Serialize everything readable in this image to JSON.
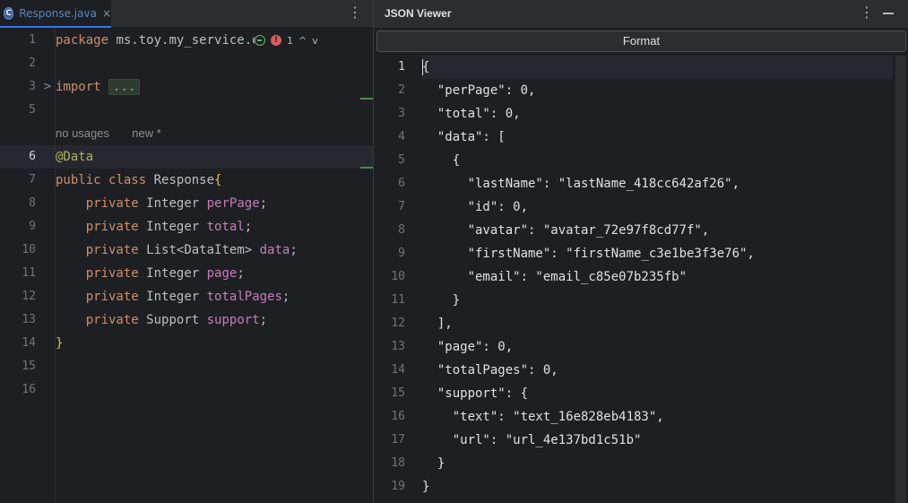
{
  "editor": {
    "tab": {
      "icon_letter": "C",
      "filename": "Response.java",
      "close_glyph": "×"
    },
    "menu_glyph": "⋮",
    "inspection": {
      "error_count": "1",
      "error_glyph": "!",
      "up_glyph": "^",
      "down_glyph": "v"
    },
    "line_numbers": [
      "1",
      "2",
      "3",
      "5",
      "6",
      "7",
      "8",
      "9",
      "10",
      "11",
      "12",
      "13",
      "14",
      "15",
      "16"
    ],
    "lines": {
      "l1_kw": "package",
      "l1_pkg": " ms.toy.my_service.d",
      "l3_kw": "import",
      "l3_fold": "...",
      "hint_usages": "no usages",
      "hint_new": "new *",
      "l6_ann": "@Data",
      "l7_kw1": "public",
      "l7_kw2": "class",
      "l7_name": "Response",
      "l7_brace": "{",
      "fields": [
        {
          "kw": "private",
          "type": "Integer",
          "name": "perPage"
        },
        {
          "kw": "private",
          "type": "Integer",
          "name": "total"
        },
        {
          "kw": "private",
          "type": "List<DataItem>",
          "name": "data"
        },
        {
          "kw": "private",
          "type": "Integer",
          "name": "page"
        },
        {
          "kw": "private",
          "type": "Integer",
          "name": "totalPages"
        },
        {
          "kw": "private",
          "type": "Support",
          "name": "support"
        }
      ],
      "semicolon": ";",
      "close_brace": "}"
    }
  },
  "json_viewer": {
    "title": "JSON Viewer",
    "menu_glyph": "⋮",
    "format_label": "Format",
    "lines": [
      "{",
      "  \"perPage\": 0,",
      "  \"total\": 0,",
      "  \"data\": [",
      "    {",
      "      \"lastName\": \"lastName_418cc642af26\",",
      "      \"id\": 0,",
      "      \"avatar\": \"avatar_72e97f8cd77f\",",
      "      \"firstName\": \"firstName_c3e1be3f3e76\",",
      "      \"email\": \"email_c85e07b235fb\"",
      "    }",
      "  ],",
      "  \"page\": 0,",
      "  \"totalPages\": 0,",
      "  \"support\": {",
      "    \"text\": \"text_16e828eb4183\",",
      "    \"url\": \"url_4e137bd1c51b\"",
      "  }",
      "}"
    ]
  },
  "colors": {
    "background": "#1e1f22",
    "keyword": "#cf8e6d",
    "field": "#c77dbb",
    "annotation": "#b3ae60",
    "accent": "#3574f0"
  }
}
